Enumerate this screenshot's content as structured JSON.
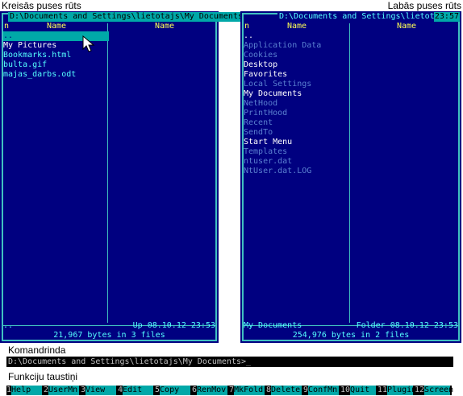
{
  "captions": {
    "left_panel": "Kreisās puses rūts",
    "right_panel": "Labās puses rūts",
    "command_line": "Komandrinda",
    "function_keys": "Funkciju taustiņi"
  },
  "left_panel": {
    "path": "D:\\Documents and Settings\\lietotajs\\My Documents",
    "col_n": "n",
    "col1_header": "Name",
    "col2_header": "Name",
    "files": [
      {
        "name": "..",
        "kind": "selected"
      },
      {
        "name": "My Pictures",
        "kind": "dir"
      },
      {
        "name": "Bookmarks.html",
        "kind": "file"
      },
      {
        "name": "bulta.gif",
        "kind": "file"
      },
      {
        "name": "majas_darbs.odt",
        "kind": "file"
      }
    ],
    "status_left": "..",
    "status_right": "Up  08.10.12 23:53",
    "summary": "21,967 bytes in 3 files"
  },
  "right_panel": {
    "path": "D:\\Documents and Settings\\lietotajs",
    "clock": "23:57",
    "col_n": "n",
    "col1_header": "Name",
    "col2_header": "Name",
    "files": [
      {
        "name": "..",
        "kind": "dots"
      },
      {
        "name": "Application Data",
        "kind": "hidden"
      },
      {
        "name": "Cookies",
        "kind": "hidden"
      },
      {
        "name": "Desktop",
        "kind": "dir"
      },
      {
        "name": "Favorites",
        "kind": "dir"
      },
      {
        "name": "Local Settings",
        "kind": "hidden"
      },
      {
        "name": "My Documents",
        "kind": "dir"
      },
      {
        "name": "NetHood",
        "kind": "hidden"
      },
      {
        "name": "PrintHood",
        "kind": "hidden"
      },
      {
        "name": "Recent",
        "kind": "hidden"
      },
      {
        "name": "SendTo",
        "kind": "hidden"
      },
      {
        "name": "Start Menu",
        "kind": "dir"
      },
      {
        "name": "Templates",
        "kind": "hidden"
      },
      {
        "name": "ntuser.dat",
        "kind": "hidden"
      },
      {
        "name": "NtUser.dat.LOG",
        "kind": "hidden"
      }
    ],
    "status_left": "My Documents",
    "status_right": "Folder 08.10.12 23:53",
    "summary": "254,976 bytes in 2 files"
  },
  "command_line": {
    "value": "D:\\Documents and Settings\\lietotajs\\My Documents>_"
  },
  "function_keys": [
    {
      "num": "1",
      "label": "Help"
    },
    {
      "num": "2",
      "label": "UserMn"
    },
    {
      "num": "3",
      "label": "View"
    },
    {
      "num": "4",
      "label": "Edit"
    },
    {
      "num": "5",
      "label": "Copy"
    },
    {
      "num": "6",
      "label": "RenMov"
    },
    {
      "num": "7",
      "label": "MkFold"
    },
    {
      "num": "8",
      "label": "Delete"
    },
    {
      "num": "9",
      "label": "ConfMn"
    },
    {
      "num": "10",
      "label": "Quit"
    },
    {
      "num": "11",
      "label": "Plugin"
    },
    {
      "num": "12",
      "label": "Screen"
    }
  ],
  "icons": {
    "mouse_cursor": "mouse-pointer-icon"
  },
  "colors": {
    "panel_bg": "#000080",
    "frame": "#40c0c0",
    "highlight": "#00a8a8",
    "header_text": "#ffff55"
  }
}
